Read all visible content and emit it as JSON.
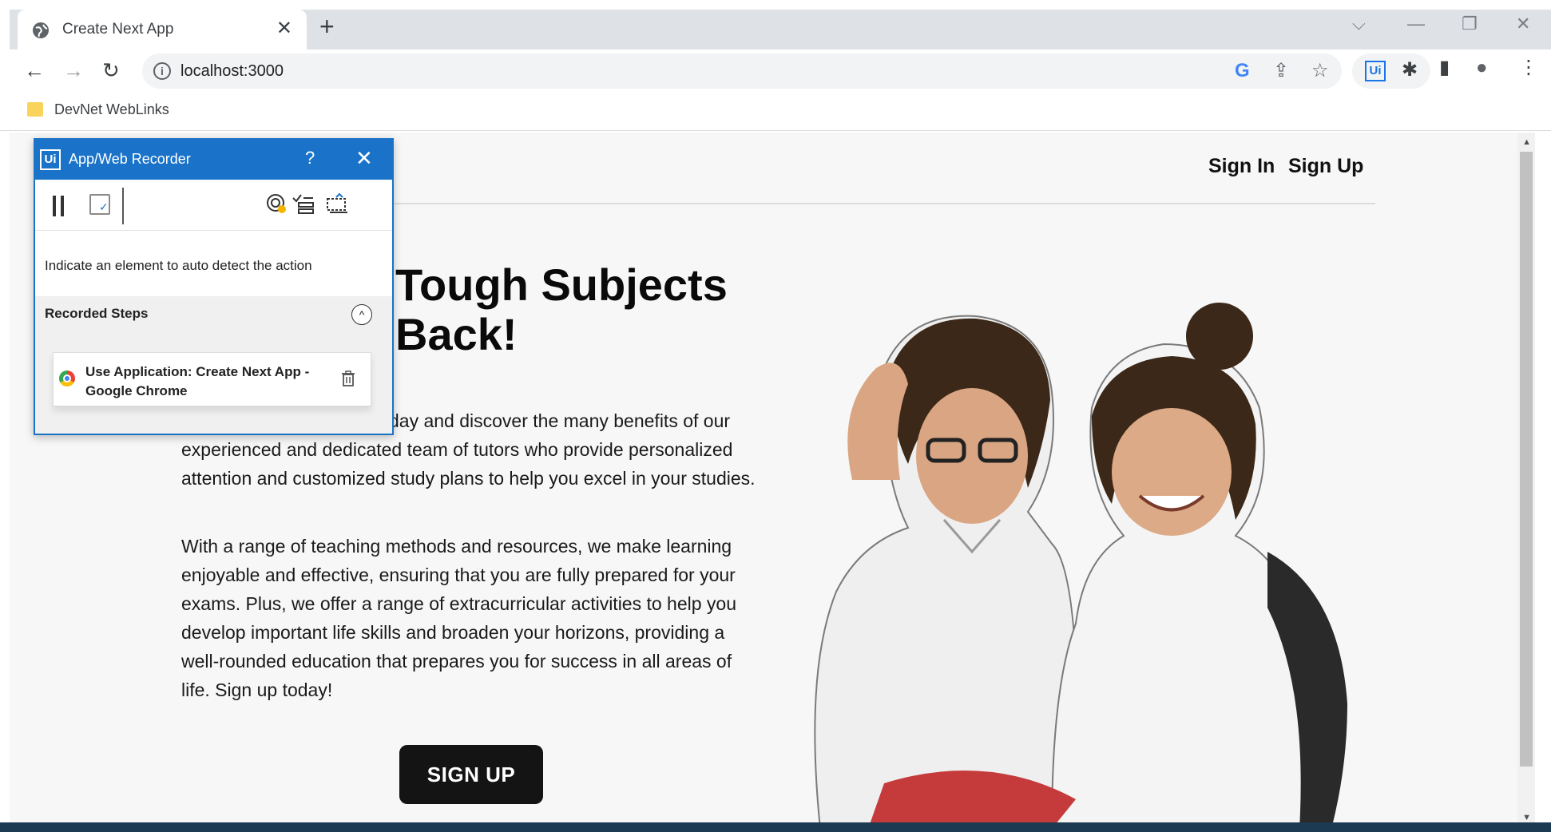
{
  "browser": {
    "tab": {
      "title": "Create Next App",
      "close": "✕"
    },
    "new_tab": "+",
    "window_controls": {
      "tabsearch": "⌵",
      "minimize": "—",
      "restore": "❐",
      "close": "✕"
    },
    "nav": {
      "back": "←",
      "forward": "→",
      "reload": "↻"
    },
    "address": {
      "info": "i",
      "url": "localhost:3000"
    },
    "omnibox_icons": {
      "google": "G",
      "share": "⇪",
      "bookmark": "☆"
    },
    "extensions": {
      "uipath": "Ui",
      "puzzle": "✱"
    },
    "toolbar_icons": {
      "sidepanel": "▮",
      "profile": "●",
      "menu": "⋮"
    },
    "bookmark": {
      "label": "DevNet WebLinks"
    }
  },
  "page": {
    "nav": {
      "sign_in": "Sign In",
      "sign_up": "Sign Up"
    },
    "hero": {
      "title_line1": "Tough Subjects",
      "title_line2": "Back!",
      "paragraph1": "day and discover the many benefits of our experienced and dedicated team of tutors who provide personalized attention and customized study plans to help you excel in your studies.",
      "paragraph2": "With a range of teaching methods and resources, we make learning enjoyable and effective, ensuring that you are fully prepared for your exams. Plus, we offer a range of extracurricular activities to help you develop important life skills and broaden your horizons, providing a well-rounded education that prepares you for success in all areas of life. Sign up today!",
      "cta": "SIGN UP"
    }
  },
  "recorder": {
    "logo": "Ui",
    "title": "App/Web Recorder",
    "help": "?",
    "close": "✕",
    "hint": "Indicate an element to auto detect the action",
    "steps_title": "Recorded Steps",
    "collapse": "^",
    "steps": [
      {
        "text": "Use Application: Create Next App - Google Chrome"
      }
    ]
  }
}
